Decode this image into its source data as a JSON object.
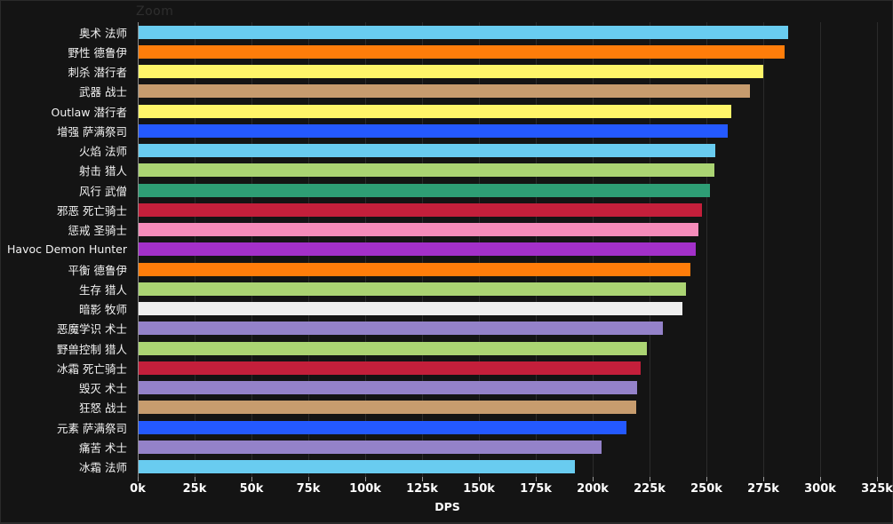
{
  "window": {
    "watermark_label": "Zoom",
    "background_color": "#141414"
  },
  "chart_data": {
    "type": "bar",
    "orientation": "horizontal",
    "title": "",
    "xlabel": "DPS",
    "ylabel": "",
    "xlim": [
      0,
      325000
    ],
    "grid": true,
    "legend": false,
    "xtick_labels": [
      "0k",
      "25k",
      "50k",
      "75k",
      "100k",
      "125k",
      "150k",
      "175k",
      "200k",
      "225k",
      "250k",
      "275k",
      "300k",
      "325k"
    ],
    "xtick_values": [
      0,
      25000,
      50000,
      75000,
      100000,
      125000,
      150000,
      175000,
      200000,
      225000,
      250000,
      275000,
      300000,
      325000
    ],
    "categories": [
      "奥术 法师",
      "野性 德鲁伊",
      "刺杀 潜行者",
      "武器 战士",
      "Outlaw 潜行者",
      "增强 萨满祭司",
      "火焰 法师",
      "射击 猎人",
      "风行 武僧",
      "邪恶 死亡骑士",
      "惩戒 圣骑士",
      "Havoc Demon Hunter",
      "平衡 德鲁伊",
      "生存 猎人",
      "暗影 牧师",
      "恶魔学识 术士",
      "野兽控制 猎人",
      "冰霜 死亡骑士",
      "毁灭 术士",
      "狂怒 战士",
      "元素 萨满祭司",
      "痛苦 术士",
      "冰霜 法师"
    ],
    "values": [
      286000,
      284500,
      275000,
      269000,
      261000,
      259500,
      254000,
      253500,
      251500,
      248000,
      246500,
      245500,
      243000,
      241000,
      239500,
      231000,
      224000,
      221000,
      219500,
      219000,
      215000,
      204000,
      192000
    ],
    "colors": [
      "#69ccf0",
      "#ff7d0a",
      "#fff569",
      "#c79c6e",
      "#fff569",
      "#2459ff",
      "#69ccf0",
      "#abd473",
      "#2e9e75",
      "#c41f3b",
      "#f58cba",
      "#a330c9",
      "#ff7d0a",
      "#abd473",
      "#eeeeee",
      "#9482c9",
      "#abd473",
      "#c41f3b",
      "#9482c9",
      "#c79c6e",
      "#2459ff",
      "#9482c9",
      "#69ccf0"
    ]
  }
}
